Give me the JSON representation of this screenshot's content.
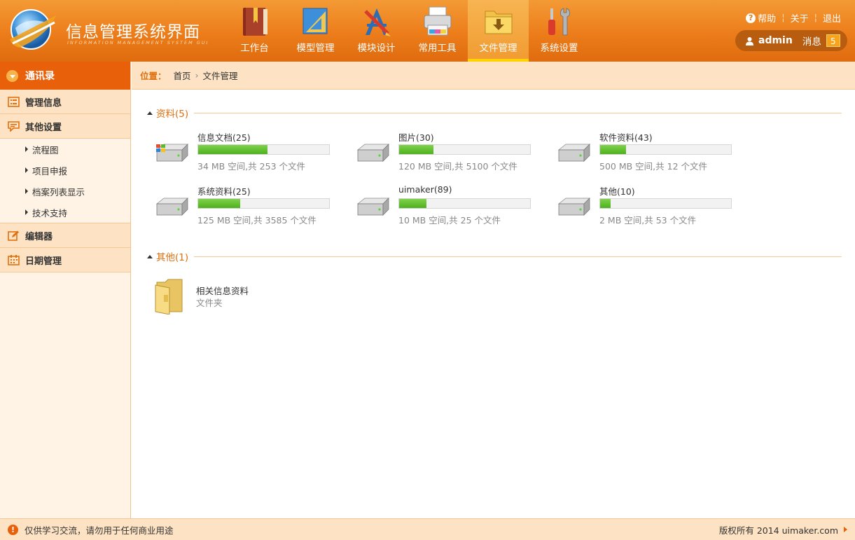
{
  "header": {
    "title": "信息管理系统界面",
    "subtitle": "INFORMATION MANAGEMENT SYSTEM GUI",
    "nav": [
      {
        "label": "工作台",
        "icon": "book-icon"
      },
      {
        "label": "模型管理",
        "icon": "ruler-icon"
      },
      {
        "label": "模块设计",
        "icon": "design-tools-icon"
      },
      {
        "label": "常用工具",
        "icon": "printer-icon"
      },
      {
        "label": "文件管理",
        "icon": "folder-download-icon",
        "active": true
      },
      {
        "label": "系统设置",
        "icon": "tools-icon"
      }
    ],
    "links": {
      "help": "帮助",
      "about": "关于",
      "logout": "退出"
    },
    "user": {
      "name": "admin",
      "message_label": "消息",
      "message_count": "5"
    }
  },
  "sidebar": {
    "header": "通讯录",
    "groups": [
      {
        "label": "管理信息",
        "icon": "list-icon"
      },
      {
        "label": "其他设置",
        "icon": "chat-icon",
        "children": [
          "流程图",
          "项目申报",
          "档案列表显示",
          "技术支持"
        ]
      },
      {
        "label": "编辑器",
        "icon": "edit-icon"
      },
      {
        "label": "日期管理",
        "icon": "calendar-icon"
      }
    ]
  },
  "breadcrumb": {
    "prefix": "位置：",
    "home": "首页",
    "current": "文件管理"
  },
  "sections": {
    "data": {
      "title": "资料(5)"
    },
    "other": {
      "title": "其他(1)"
    }
  },
  "drives": [
    {
      "name": "信息文档(25)",
      "info": "34 MB 空间,共 253 个文件",
      "usage": 0.53,
      "icon": "windows-drive-icon"
    },
    {
      "name": "图片(30)",
      "info": "120 MB 空间,共 5100 个文件",
      "usage": 0.26,
      "icon": "drive-icon"
    },
    {
      "name": "软件资料(43)",
      "info": "500 MB 空间,共 12 个文件",
      "usage": 0.2,
      "icon": "drive-icon"
    },
    {
      "name": "系统资料(25)",
      "info": "125 MB 空间,共 3585 个文件",
      "usage": 0.32,
      "icon": "drive-icon"
    },
    {
      "name": "uimaker(89)",
      "info": "10 MB 空间,共 25 个文件",
      "usage": 0.21,
      "icon": "drive-icon"
    },
    {
      "name": "其他(10)",
      "info": "2 MB 空间,共 53 个文件",
      "usage": 0.08,
      "icon": "drive-icon"
    }
  ],
  "folder": {
    "name": "相关信息资料",
    "type": "文件夹"
  },
  "footer": {
    "notice": "仅供学习交流，请勿用于任何商业用途",
    "copyright": "版权所有 2014 uimaker.com"
  },
  "colors": {
    "accent": "#e8600a",
    "header": "#ec7d1a",
    "sidebar_bg": "#fef3e4",
    "progress": "#4fb11e"
  }
}
